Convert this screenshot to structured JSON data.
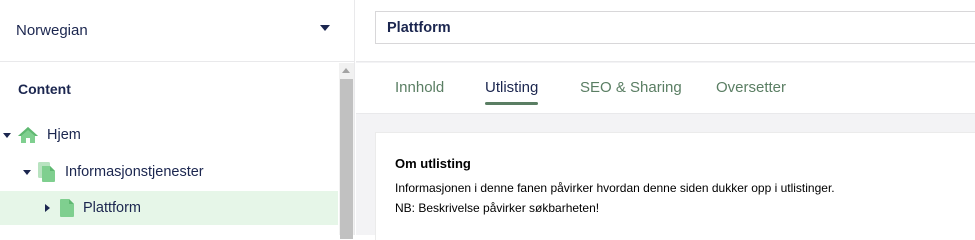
{
  "language": {
    "selected": "Norwegian",
    "caret_icon": "chevron-down-icon"
  },
  "tree": {
    "header": "Content",
    "nodes": [
      {
        "label": "Hjem",
        "icon": "home-icon",
        "state": "expanded"
      },
      {
        "label": "Informasjonstjenester",
        "icon": "document-icon",
        "state": "expanded"
      },
      {
        "label": "Plattform",
        "icon": "document-icon",
        "state": "collapsed",
        "selected": true
      }
    ]
  },
  "editor": {
    "name_value": "Plattform",
    "tabs": [
      {
        "label": "Innhold"
      },
      {
        "label": "Utlisting",
        "active": true
      },
      {
        "label": "SEO & Sharing"
      },
      {
        "label": "Oversetter"
      }
    ],
    "card": {
      "title": "Om utlisting",
      "line1": "Informasjonen i denne fanen påvirker hvordan denne siden dukker opp i utlistinger.",
      "line2": "NB: Beskrivelse påvirker søkbarheten!"
    }
  },
  "colors": {
    "accent_green": "#5a7e63",
    "text_navy": "#1b264f",
    "selected_row_bg": "#e6f6e8",
    "icon_green": "#7fcf8f"
  }
}
